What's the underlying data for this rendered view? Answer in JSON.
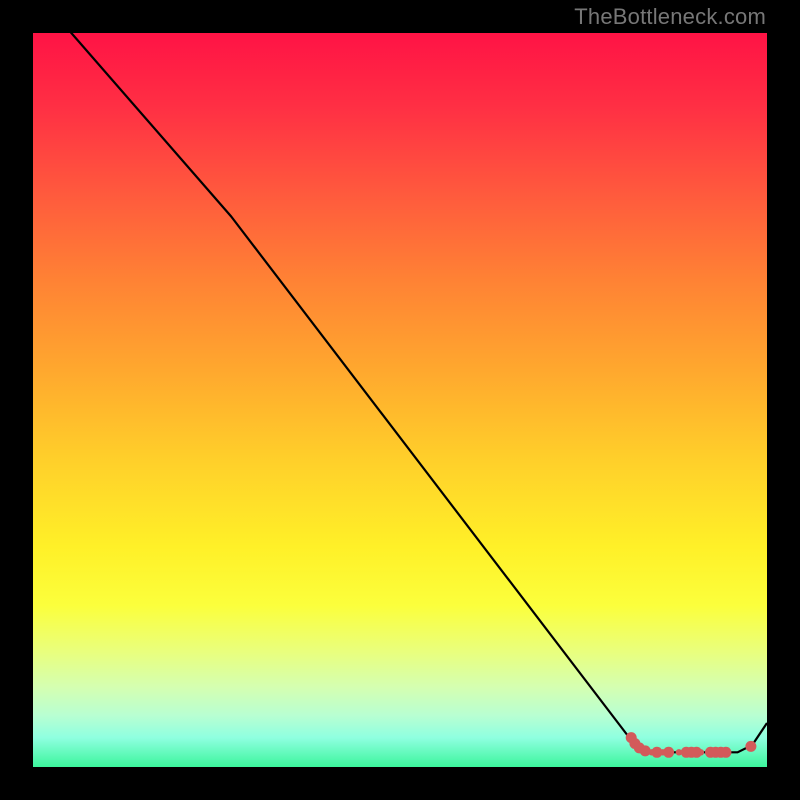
{
  "watermark": "TheBottleneck.com",
  "chart_data": {
    "type": "line",
    "title": "",
    "xlabel": "",
    "ylabel": "",
    "xlim": [
      0,
      100
    ],
    "ylim": [
      0,
      100
    ],
    "series": [
      {
        "name": "curve",
        "x": [
          0,
          27,
          82,
          84,
          96,
          98,
          100
        ],
        "y": [
          106,
          75,
          3,
          2,
          2,
          3,
          6
        ],
        "stroke": "#000000",
        "width": 2.2
      }
    ],
    "markers": {
      "name": "highlight-dots",
      "stroke": "#d35a5a",
      "fill": "#d35a5a",
      "r_small": 3.2,
      "r_big": 5.5,
      "points": [
        {
          "x": 81.5,
          "y": 4.0,
          "big": true
        },
        {
          "x": 82.0,
          "y": 3.2,
          "big": true
        },
        {
          "x": 82.6,
          "y": 2.6,
          "big": true
        },
        {
          "x": 83.4,
          "y": 2.2,
          "big": true
        },
        {
          "x": 84.3,
          "y": 2.0,
          "big": false
        },
        {
          "x": 85.0,
          "y": 2.0,
          "big": true
        },
        {
          "x": 85.8,
          "y": 2.0,
          "big": false
        },
        {
          "x": 86.6,
          "y": 2.0,
          "big": true
        },
        {
          "x": 88.0,
          "y": 2.0,
          "big": false
        },
        {
          "x": 89.0,
          "y": 2.0,
          "big": true
        },
        {
          "x": 89.7,
          "y": 2.0,
          "big": true
        },
        {
          "x": 90.4,
          "y": 2.0,
          "big": true
        },
        {
          "x": 91.0,
          "y": 2.0,
          "big": false
        },
        {
          "x": 92.3,
          "y": 2.0,
          "big": true
        },
        {
          "x": 93.0,
          "y": 2.0,
          "big": true
        },
        {
          "x": 93.7,
          "y": 2.0,
          "big": true
        },
        {
          "x": 94.4,
          "y": 2.0,
          "big": true
        },
        {
          "x": 97.8,
          "y": 2.8,
          "big": true
        }
      ]
    },
    "gradient_stops": [
      {
        "pos": 0,
        "color": "#ff1345"
      },
      {
        "pos": 10,
        "color": "#ff2f44"
      },
      {
        "pos": 22,
        "color": "#ff5a3d"
      },
      {
        "pos": 34,
        "color": "#ff8334"
      },
      {
        "pos": 46,
        "color": "#ffa82e"
      },
      {
        "pos": 58,
        "color": "#ffcf2a"
      },
      {
        "pos": 70,
        "color": "#fff028"
      },
      {
        "pos": 78,
        "color": "#fbff3c"
      },
      {
        "pos": 84,
        "color": "#eaff7a"
      },
      {
        "pos": 89,
        "color": "#d5ffb0"
      },
      {
        "pos": 93,
        "color": "#b8ffd2"
      },
      {
        "pos": 96,
        "color": "#8fffe0"
      },
      {
        "pos": 100,
        "color": "#3cf59c"
      }
    ]
  }
}
